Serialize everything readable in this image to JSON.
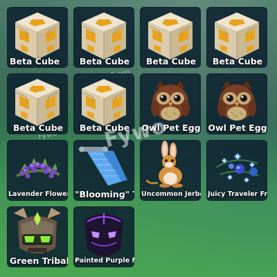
{
  "watermark": "Fywo",
  "items": [
    {
      "name": "Beta Cube",
      "art": "beta-cube"
    },
    {
      "name": "Beta Cube",
      "art": "beta-cube"
    },
    {
      "name": "Beta Cube",
      "art": "beta-cube"
    },
    {
      "name": "Beta Cube",
      "art": "beta-cube"
    },
    {
      "name": "Beta Cube",
      "art": "beta-cube"
    },
    {
      "name": "Beta Cube",
      "art": "beta-cube"
    },
    {
      "name": "Owl Pet Egg",
      "art": "owl-pet"
    },
    {
      "name": "Owl Pet Egg",
      "art": "owl-pet"
    },
    {
      "name": "Lavender Flower Tiara",
      "art": "lavender-tiara"
    },
    {
      "name": "\"Blooming\" Title",
      "art": "blooming-scroll"
    },
    {
      "name": "Uncommon Jerboa Egg",
      "art": "jerboa-pet"
    },
    {
      "name": "Juicy Traveler Fruit",
      "art": "traveler-fruit"
    },
    {
      "name": "Green Tribal Mask",
      "art": "green-tribal-mask"
    },
    {
      "name": "Painted Purple Mask",
      "art": "painted-purple-mask"
    }
  ],
  "colors": {
    "tile_bg": "#0e2230",
    "cube_stone": "#e8dcc2",
    "cube_gold": "#e8a21a",
    "owl_brown": "#7a3f24",
    "mask_green": "#8cf03a",
    "mask_purple": "#a24cff"
  }
}
